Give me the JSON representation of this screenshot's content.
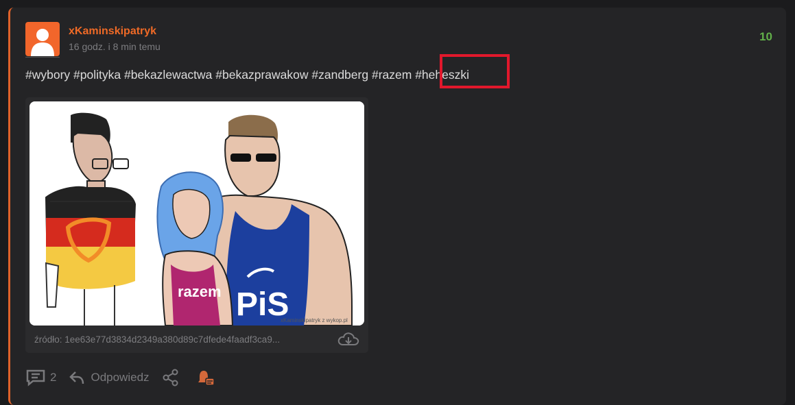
{
  "post": {
    "username": "xKaminskipatryk",
    "timestamp": "16 godz. i 8 min temu",
    "votes": "10",
    "tags": [
      "#wybory",
      "#polityka",
      "#bekazlewactwa",
      "#bekazprawakow",
      "#zandberg",
      "#razem",
      "#heheszki"
    ],
    "highlighted_tag": "#heheszki"
  },
  "embed": {
    "source_label": "źródło: 1ee63e77d3834d2349a380d89c7dfede4faadf3ca9...",
    "image_shirt_text_1": "razem",
    "image_shirt_text_2": "PiS",
    "image_watermark": "xKaminskipatryk z  wykop.pl"
  },
  "actions": {
    "comments_count": "2",
    "reply_label": "Odpowiedz"
  },
  "colors": {
    "accent": "#ef6a26",
    "votes": "#62b04a",
    "highlight_box": "#e1182c",
    "background": "#1b1b1d",
    "card": "#242426"
  }
}
